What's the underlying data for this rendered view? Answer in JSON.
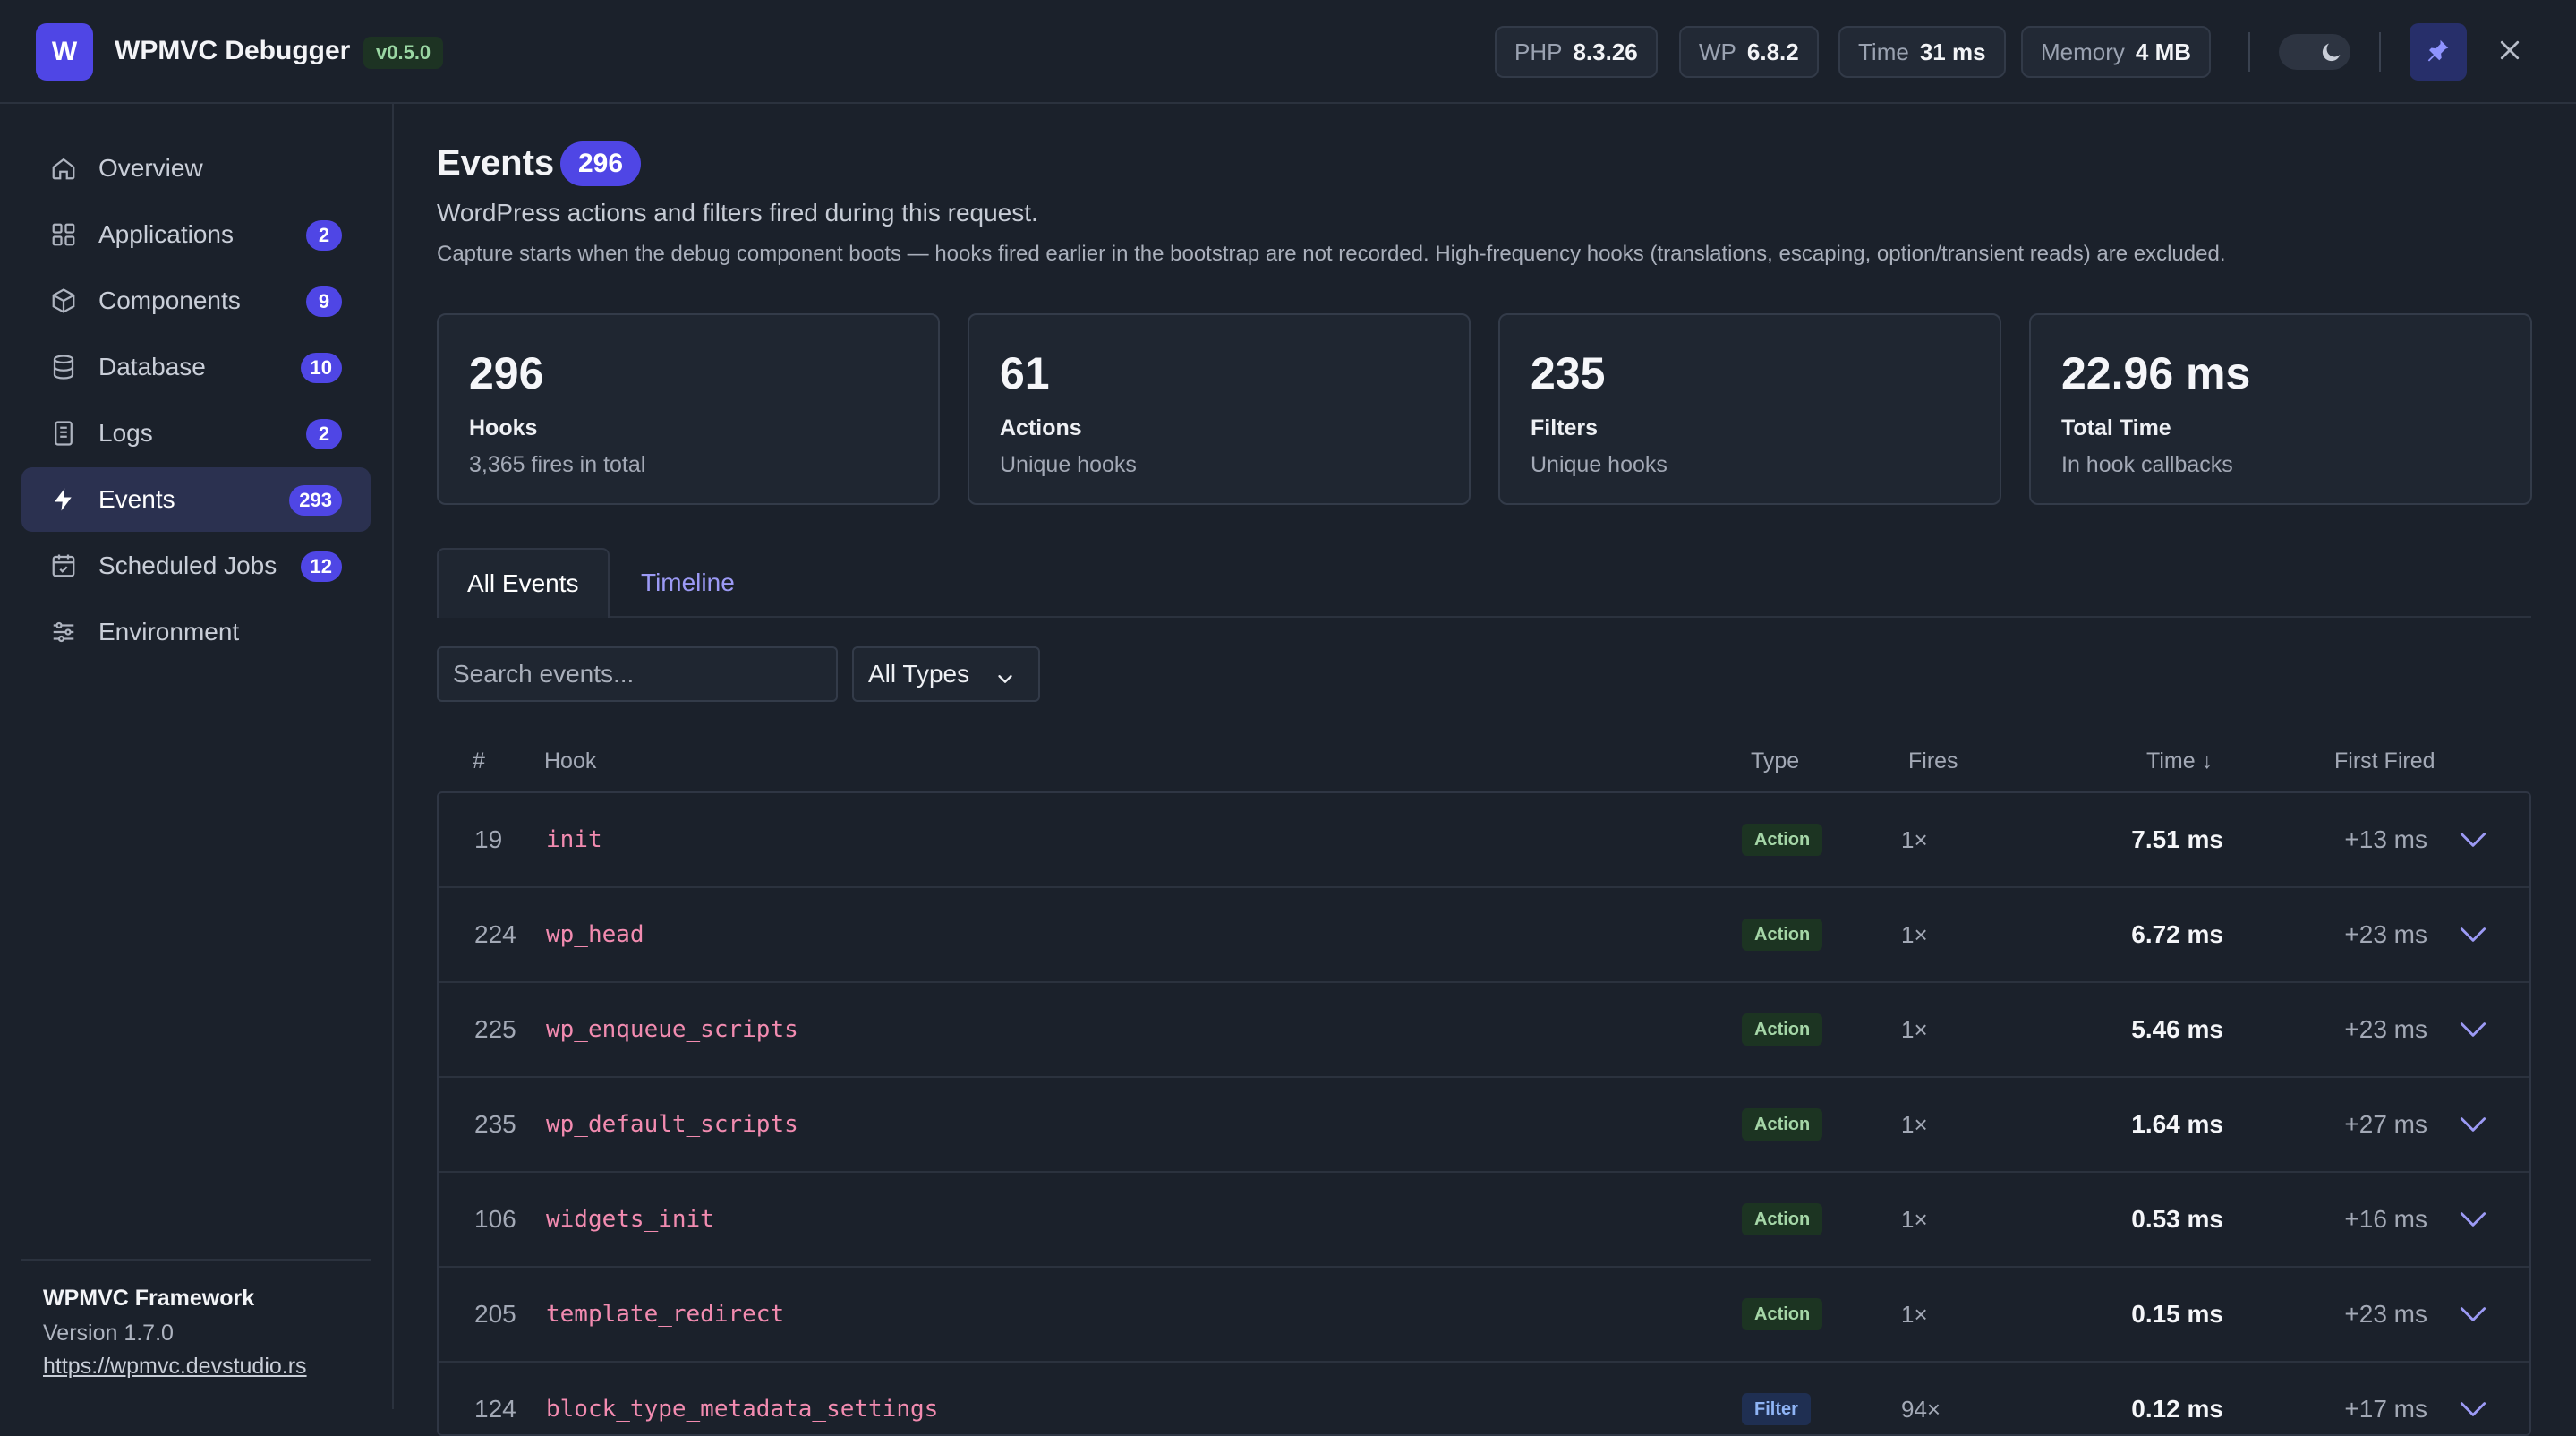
{
  "header": {
    "logo_letter": "W",
    "title": "WPMVC Debugger",
    "version": "v0.5.0",
    "stats": [
      {
        "key": "PHP",
        "value": "8.3.26"
      },
      {
        "key": "WP",
        "value": "6.8.2"
      },
      {
        "key": "Time",
        "value": "31 ms"
      },
      {
        "key": "Memory",
        "value": "4 MB"
      }
    ],
    "icons": {
      "theme": "moon-icon",
      "pin": "pin-icon",
      "close": "close-icon"
    }
  },
  "sidebar": {
    "items": [
      {
        "label": "Overview",
        "badge": "",
        "icon": "home-icon"
      },
      {
        "label": "Applications",
        "badge": "2",
        "icon": "grid-icon"
      },
      {
        "label": "Components",
        "badge": "9",
        "icon": "box-icon"
      },
      {
        "label": "Database",
        "badge": "10",
        "icon": "database-icon"
      },
      {
        "label": "Logs",
        "badge": "2",
        "icon": "document-icon"
      },
      {
        "label": "Events",
        "badge": "293",
        "icon": "bolt-icon"
      },
      {
        "label": "Scheduled Jobs",
        "badge": "12",
        "icon": "calendar-check-icon"
      },
      {
        "label": "Environment",
        "badge": "",
        "icon": "sliders-icon"
      }
    ],
    "active": "Events",
    "footer": {
      "framework": "WPMVC Framework",
      "version": "Version 1.7.0",
      "link": "https://wpmvc.devstudio.rs"
    }
  },
  "main": {
    "title": "Events",
    "title_badge": "296",
    "subtitle": "WordPress actions and filters fired during this request.",
    "note": "Capture starts when the debug component boots — hooks fired earlier in the bootstrap are not recorded. High-frequency hooks (translations, escaping, option/transient reads) are excluded.",
    "stats": [
      {
        "value": "296",
        "label": "Hooks",
        "sub": "3,365 fires in total"
      },
      {
        "value": "61",
        "label": "Actions",
        "sub": "Unique hooks"
      },
      {
        "value": "235",
        "label": "Filters",
        "sub": "Unique hooks"
      },
      {
        "value": "22.96 ms",
        "label": "Total Time",
        "sub": "In hook callbacks"
      }
    ],
    "tabs": [
      {
        "label": "All Events",
        "active": true
      },
      {
        "label": "Timeline",
        "active": false
      }
    ],
    "search": {
      "placeholder": "Search events...",
      "value": ""
    },
    "type_filter": {
      "selected": "All Types"
    },
    "table": {
      "headers": {
        "idx": "#",
        "hook": "Hook",
        "type": "Type",
        "fires": "Fires",
        "time": "Time ↓",
        "first": "First Fired"
      },
      "rows": [
        {
          "idx": "19",
          "hook": "init",
          "type": "Action",
          "fires": "1×",
          "time": "7.51 ms",
          "first": "+13 ms"
        },
        {
          "idx": "224",
          "hook": "wp_head",
          "type": "Action",
          "fires": "1×",
          "time": "6.72 ms",
          "first": "+23 ms"
        },
        {
          "idx": "225",
          "hook": "wp_enqueue_scripts",
          "type": "Action",
          "fires": "1×",
          "time": "5.46 ms",
          "first": "+23 ms"
        },
        {
          "idx": "235",
          "hook": "wp_default_scripts",
          "type": "Action",
          "fires": "1×",
          "time": "1.64 ms",
          "first": "+27 ms"
        },
        {
          "idx": "106",
          "hook": "widgets_init",
          "type": "Action",
          "fires": "1×",
          "time": "0.53 ms",
          "first": "+16 ms"
        },
        {
          "idx": "205",
          "hook": "template_redirect",
          "type": "Action",
          "fires": "1×",
          "time": "0.15 ms",
          "first": "+23 ms"
        },
        {
          "idx": "124",
          "hook": "block_type_metadata_settings",
          "type": "Filter",
          "fires": "94×",
          "time": "0.12 ms",
          "first": "+17 ms"
        }
      ]
    }
  },
  "colors": {
    "accent": "#4f46e5",
    "hook": "#f28bb0",
    "action_badge": "#1c3422",
    "filter_badge": "#1f2f52"
  }
}
